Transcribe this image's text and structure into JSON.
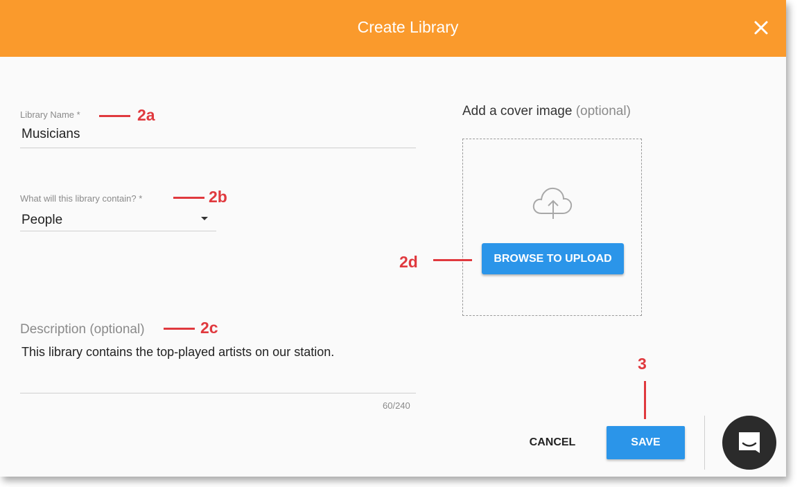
{
  "dialog": {
    "title": "Create Library"
  },
  "form": {
    "library_name": {
      "label": "Library Name",
      "required_mark": "*",
      "value": "Musicians"
    },
    "contains": {
      "label": "What will this library contain?",
      "required_mark": "*",
      "value": "People"
    },
    "description": {
      "label": "Description",
      "optional": "(optional)",
      "value": "This library contains the top-played artists on our station.",
      "counter": "60/240"
    }
  },
  "cover": {
    "label": "Add a cover image",
    "optional": "(optional)",
    "browse_label": "BROWSE TO UPLOAD"
  },
  "footer": {
    "cancel_label": "CANCEL",
    "save_label": "SAVE"
  },
  "annotations": {
    "a": "2a",
    "b": "2b",
    "c": "2c",
    "d": "2d",
    "save": "3"
  },
  "colors": {
    "header": "#fa9a2c",
    "primary": "#2b95e9",
    "annotation": "#e0393e"
  },
  "icons": {
    "close": "close-icon",
    "upload": "cloud-upload-icon",
    "dropdown": "caret-down-icon",
    "chat": "chat-icon"
  }
}
